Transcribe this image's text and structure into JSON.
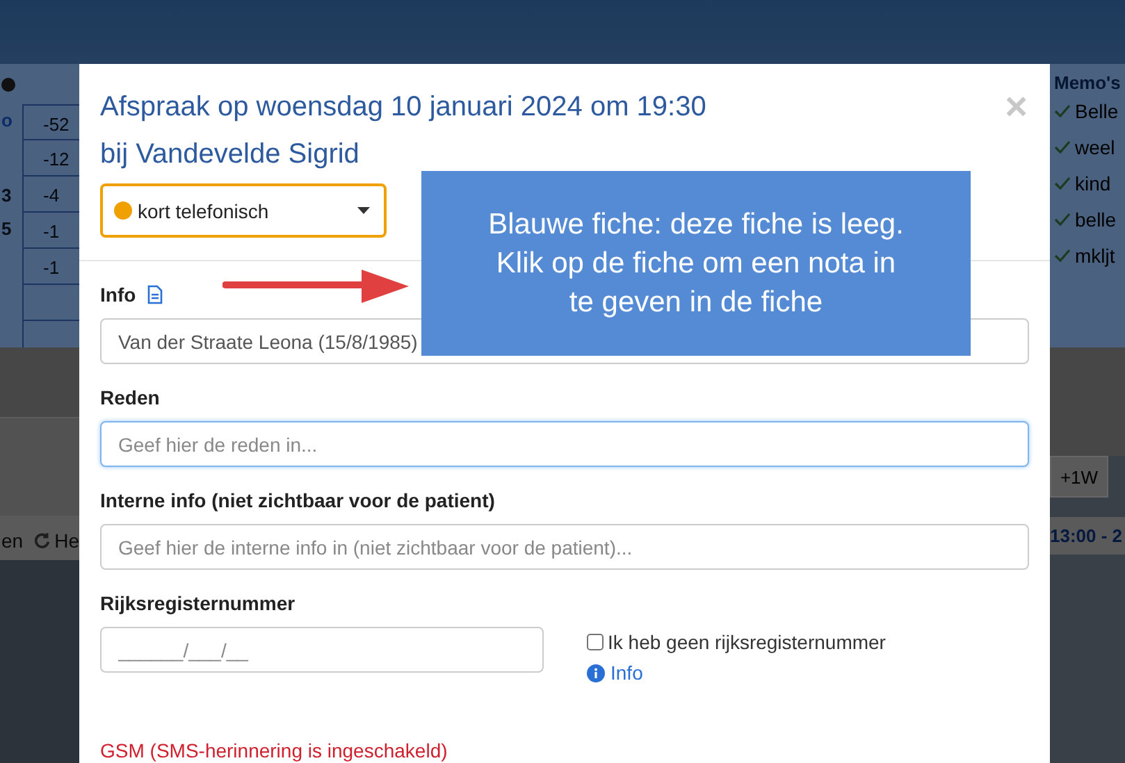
{
  "background_left": {
    "link": "o",
    "table_cells": [
      "-52",
      "-12",
      "-4",
      "-1",
      "-1",
      ""
    ],
    "side_labels": [
      "3",
      "5"
    ],
    "toolbar": [
      "en",
      "He"
    ]
  },
  "background_right": {
    "memos_title": "Memo's",
    "memos": [
      {
        "text": "Belle",
        "done": true
      },
      {
        "text": "weel",
        "done": true
      },
      {
        "text": "kind",
        "done": true
      },
      {
        "text": "belle",
        "done": true
      },
      {
        "text": "mkljt",
        "done": true
      }
    ],
    "week_button": "+1W",
    "time_range": "13:00 - 2"
  },
  "dialog": {
    "title": "Afspraak op woensdag 10 januari 2024 om 19:30",
    "subtitle": "bij Vandevelde Sigrid",
    "close": "×",
    "type_select": {
      "value": "kort telefonisch",
      "color": "#f0a000"
    },
    "fields": [
      {
        "kind": "text",
        "label": "Info",
        "value": "Van der Straate Leona (15/8/1985)",
        "focused": false,
        "doc_icon": true
      },
      {
        "kind": "text",
        "label": "Reden",
        "placeholder": "Geef hier de reden in...",
        "focused": true,
        "doc_icon": false
      },
      {
        "kind": "text",
        "label": "Interne info (niet zichtbaar voor de patient)",
        "placeholder": "Geef hier de interne info in (niet zichtbaar voor de patient)...",
        "focused": false,
        "doc_icon": false
      },
      {
        "kind": "national_id",
        "label": "Rijksregisternummer",
        "placeholder": "______/___/__",
        "focused": false,
        "doc_icon": false,
        "checkbox": {
          "label": "Ik heb geen rijksregisternummer",
          "checked": false
        },
        "info_link": "Info"
      }
    ],
    "sms_label": "GSM (SMS-herinnering is ingeschakeld)"
  },
  "callout": {
    "lines": [
      "Blauwe fiche: deze fiche is leeg.",
      "Klik op de fiche om een nota in",
      "te geven in de fiche"
    ]
  }
}
